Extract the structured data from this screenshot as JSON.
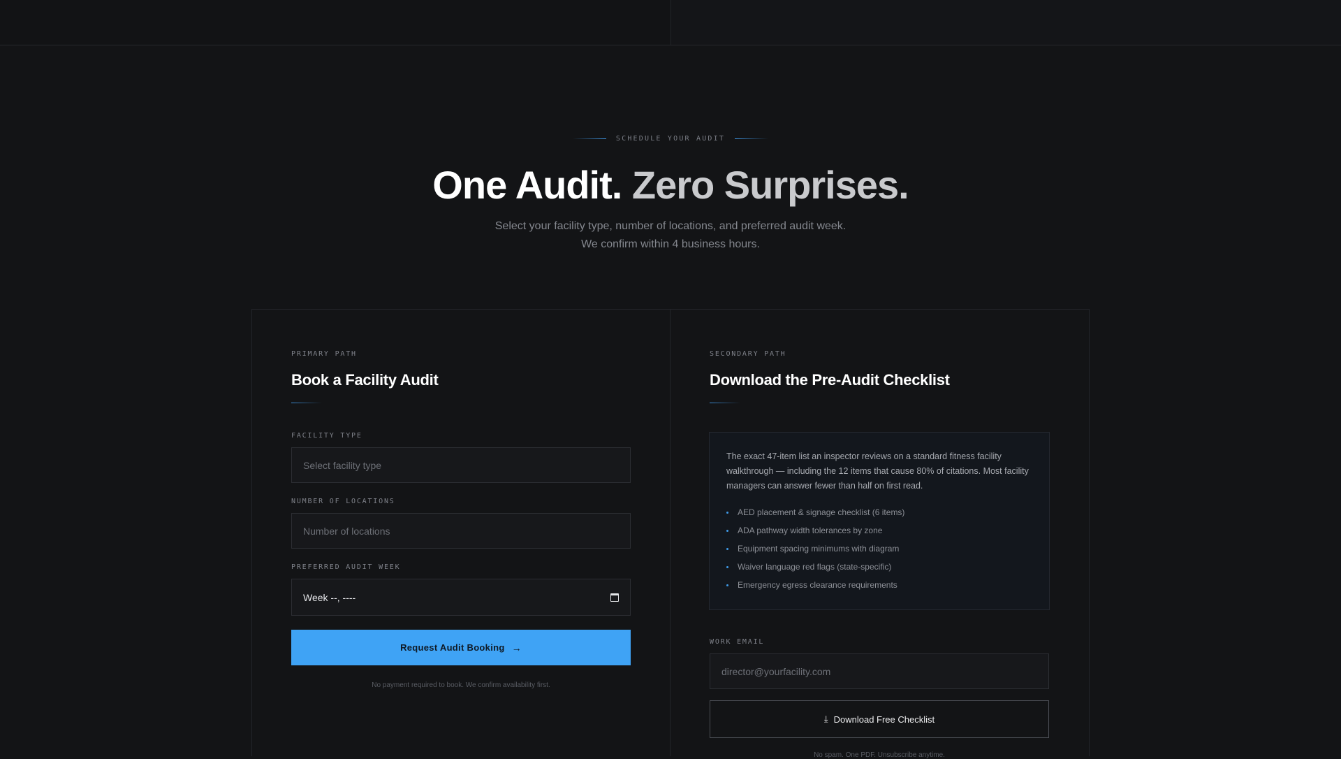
{
  "hero": {
    "eyebrow": "SCHEDULE YOUR AUDIT",
    "title_main": "One Audit.",
    "title_muted": "Zero Surprises.",
    "subtitle_line1": "Select your facility type, number of locations, and preferred audit week.",
    "subtitle_line2": "We confirm within 4 business hours."
  },
  "primary": {
    "path_label": "PRIMARY PATH",
    "title": "Book a Facility Audit",
    "facility_type_label": "FACILITY TYPE",
    "facility_type_placeholder": "Select facility type",
    "locations_label": "NUMBER OF LOCATIONS",
    "locations_placeholder": "Number of locations",
    "week_label": "PREFERRED AUDIT WEEK",
    "week_value": "Week --, ----",
    "button_label": "Request Audit Booking",
    "button_icon": "arrow-right-icon",
    "fine_print": "No payment required to book. We confirm availability first."
  },
  "secondary": {
    "path_label": "SECONDARY PATH",
    "title": "Download the Pre-Audit Checklist",
    "description": "The exact 47-item list an inspector reviews on a standard fitness facility walkthrough — including the 12 items that cause 80% of citations. Most facility managers can answer fewer than half on first read.",
    "items": [
      "AED placement & signage checklist (6 items)",
      "ADA pathway width tolerances by zone",
      "Equipment spacing minimums with diagram",
      "Waiver language red flags (state-specific)",
      "Emergency egress clearance requirements"
    ],
    "email_label": "WORK EMAIL",
    "email_placeholder": "director@yourfacility.com",
    "button_label": "Download Free Checklist",
    "button_icon": "download-icon",
    "fine_print": "No spam. One PDF. Unsubscribe anytime."
  },
  "colors": {
    "accent": "#3fa3f5",
    "background": "#131416"
  }
}
